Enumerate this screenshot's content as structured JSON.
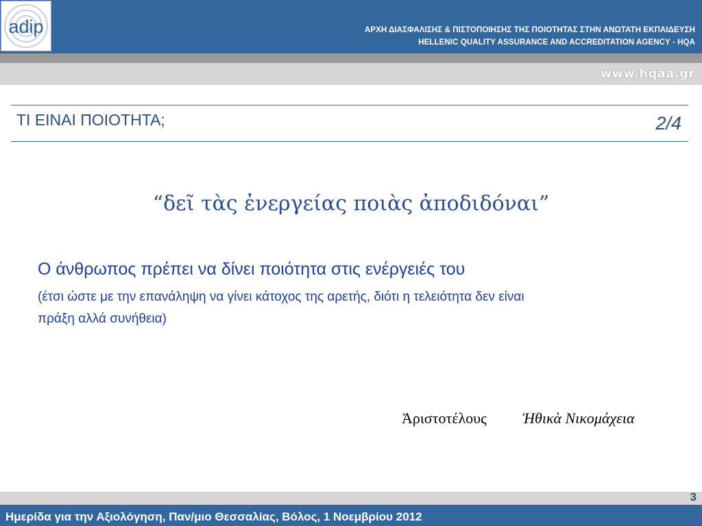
{
  "header": {
    "logo_text": "adip",
    "org_name_greek": "ΑΡΧΗ ΔΙΑΣΦΑΛΙΣΗΣ & ΠΙΣΤΟΠΟΙΗΣΗΣ ΤΗΣ ΠΟΙΟΤΗΤΑΣ ΣΤΗΝ ΑΝΩΤΑΤΗ ΕΚΠΑΙΔΕΥΣΗ",
    "org_name_english": "HELLENIC QUALITY ASSURANCE AND ACCREDITATION AGENCY - HQA",
    "website": "www.hqaa.gr",
    "colors": {
      "header_blue": "#34679e",
      "band_grey": "#d6d6d6",
      "band_dark_grey": "#9a9a9a"
    }
  },
  "slide": {
    "title": "ΤΙ ΕΙΝΑΙ ΠΟΙΟΤΗΤΑ;",
    "counter": "2/4",
    "quote": "“δεῖ τὰς ἐνεργείας ποιὰς ἀποδιδόναι”",
    "main_line": "Ο άνθρωπος πρέπει να δίνει ποιότητα στις ενέργειές του",
    "sub_line_1": "(έτσι ώστε με την επανάληψη να γίνει κάτοχος της αρετής, διότι η τελειότητα δεν είναι",
    "sub_line_2": "πράξη αλλά συνήθεια)",
    "author": "Ἀριστοτέλους",
    "work": "Ἠθικὰ Νικομάχεια",
    "colors": {
      "title": "#2b4d76",
      "body_text": "#1f3f92"
    }
  },
  "footer": {
    "page_number": "3",
    "event_text": "Ημερίδα για την Αξιολόγηση, Παν/μιο Θεσσαλίας, Βόλος, 1 Νοεμβρίου 2012"
  }
}
